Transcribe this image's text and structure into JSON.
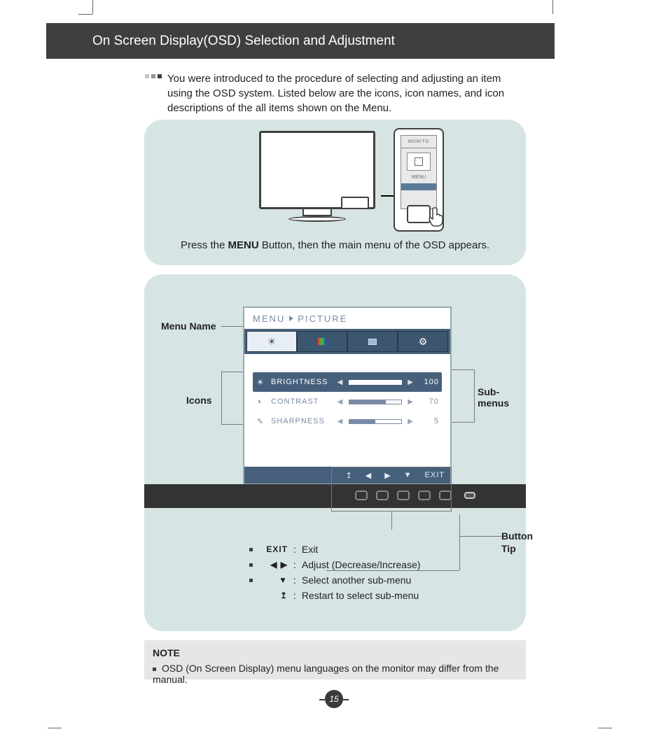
{
  "header": {
    "title": "On Screen Display(OSD) Selection and Adjustment"
  },
  "intro": "You were introduced to the procedure of selecting and adjusting an item using the OSD system. Listed below are the icons, icon names, and icon descriptions of the all items shown on the Menu.",
  "panel1": {
    "zoom_top": "MONITO",
    "zoom_menu": "MENU",
    "press_pre": "Press the ",
    "press_bold": "MENU",
    "press_post": " Button, then the main menu of the OSD appears."
  },
  "annotations": {
    "menu_name": "Menu Name",
    "icons": "Icons",
    "submenus": "Sub-menus",
    "button_tip": "Button Tip"
  },
  "osd": {
    "title_left": "MENU",
    "title_right": "PICTURE",
    "rows": [
      {
        "icon": "☀",
        "label": "BRIGHTNESS",
        "value": 100,
        "pct": 100,
        "active": true
      },
      {
        "icon": "◐",
        "label": "CONTRAST",
        "value": 70,
        "pct": 70,
        "active": false
      },
      {
        "icon": "✎",
        "label": "SHARPNESS",
        "value": 5,
        "pct": 50,
        "active": false
      }
    ],
    "bottom": {
      "return": "↥",
      "left": "◀",
      "right": "▶",
      "down": "▼",
      "exit": "EXIT"
    }
  },
  "legend": [
    {
      "sym": "EXIT",
      "desc": "Exit"
    },
    {
      "sym": "◀ ▶",
      "desc": "Adjust (Decrease/Increase)"
    },
    {
      "sym": "▼",
      "desc": "Select another sub-menu"
    },
    {
      "sym": "↥",
      "desc": "Restart to select sub-menu"
    }
  ],
  "note": {
    "label": "NOTE",
    "text": "OSD (On Screen Display) menu languages on the monitor may differ from the manual."
  },
  "page_number": "15"
}
